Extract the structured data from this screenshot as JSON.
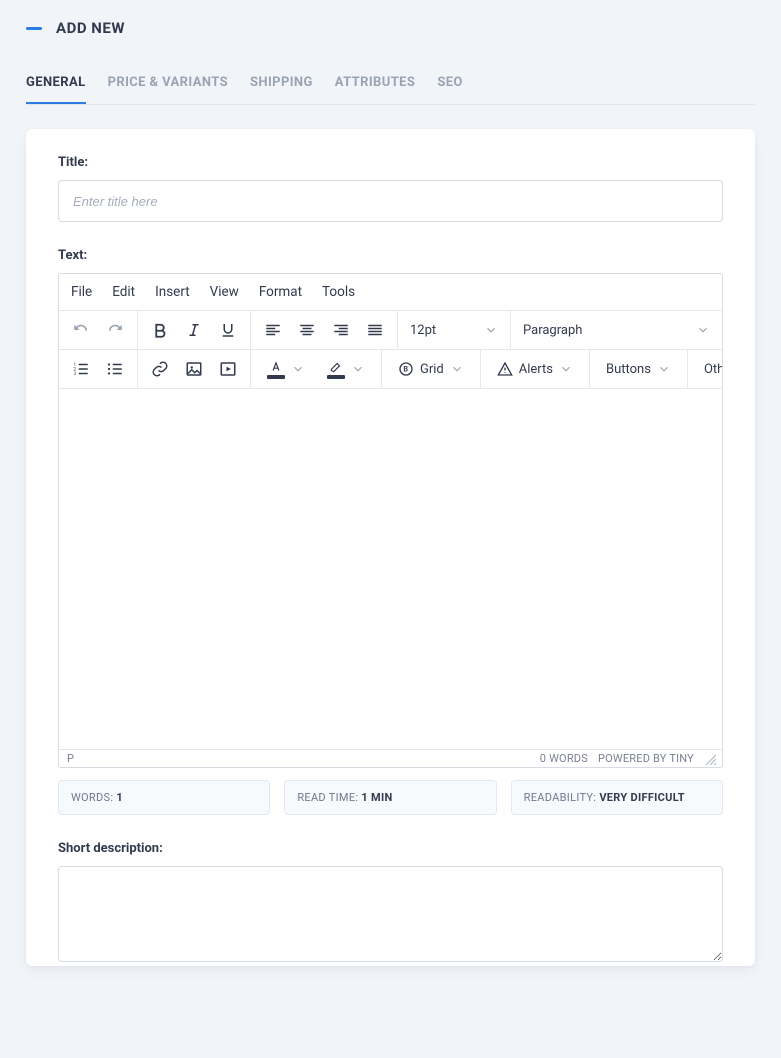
{
  "header": {
    "title": "ADD NEW"
  },
  "tabs": [
    {
      "label": "GENERAL",
      "active": true
    },
    {
      "label": "PRICE & VARIANTS"
    },
    {
      "label": "SHIPPING"
    },
    {
      "label": "ATTRIBUTES"
    },
    {
      "label": "SEO"
    }
  ],
  "form": {
    "title_label": "Title:",
    "title_placeholder": "Enter title here",
    "text_label": "Text:",
    "short_desc_label": "Short description:"
  },
  "editor": {
    "menu": {
      "file": "File",
      "edit": "Edit",
      "insert": "Insert",
      "view": "View",
      "format": "Format",
      "tools": "Tools"
    },
    "font_size": "12pt",
    "block_format": "Paragraph",
    "ext": {
      "grid": "Grid",
      "alerts": "Alerts",
      "buttons": "Buttons",
      "other": "Other"
    },
    "status_path": "P",
    "word_count": "0 WORDS",
    "branding": "POWERED BY TINY"
  },
  "stats": {
    "words_label": "WORDS: ",
    "words_value": "1",
    "readtime_label": "READ TIME: ",
    "readtime_value": "1 MIN",
    "readability_label": "READABILITY: ",
    "readability_value": "VERY DIFFICULT"
  }
}
